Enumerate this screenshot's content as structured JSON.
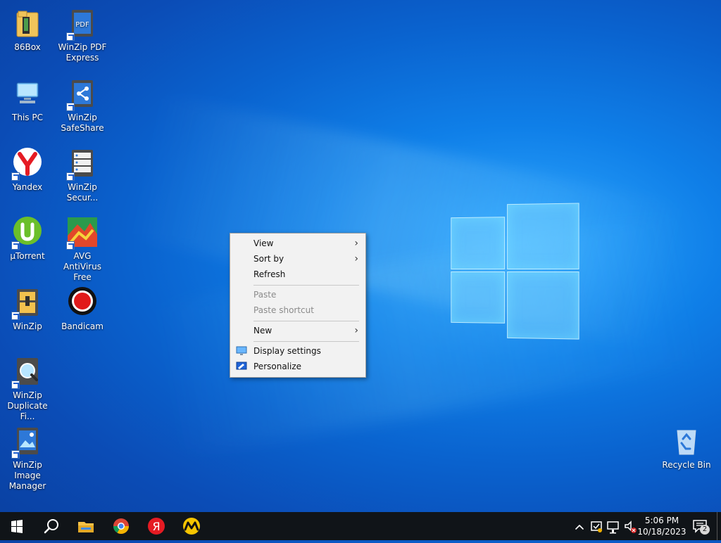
{
  "desktop": {
    "icons": [
      {
        "label": "86Box",
        "icon": "folder-icon"
      },
      {
        "label": "WinZip PDF Express",
        "icon": "pdf-document-icon"
      },
      {
        "label": "This PC",
        "icon": "computer-icon"
      },
      {
        "label": "WinZip SafeShare",
        "icon": "share-icon"
      },
      {
        "label": "Yandex",
        "icon": "yandex-browser-icon"
      },
      {
        "label": "WinZip Secur...",
        "icon": "server-icon"
      },
      {
        "label": "µTorrent",
        "icon": "utorrent-icon"
      },
      {
        "label": "AVG AntiVirus Free",
        "icon": "avg-icon"
      },
      {
        "label": "WinZip",
        "icon": "winzip-icon"
      },
      {
        "label": "Bandicam",
        "icon": "record-icon"
      },
      {
        "label": "WinZip Duplicate Fi...",
        "icon": "duplicate-finder-icon"
      },
      {
        "label": "WinZip Image Manager",
        "icon": "image-icon"
      },
      {
        "label": "Recycle Bin",
        "icon": "recycle-bin-icon"
      }
    ]
  },
  "context_menu": {
    "view": "View",
    "sort_by": "Sort by",
    "refresh": "Refresh",
    "paste": "Paste",
    "paste_shortcut": "Paste shortcut",
    "new": "New",
    "display_settings": "Display settings",
    "personalize": "Personalize"
  },
  "taskbar": {
    "pinned": [
      "start-icon",
      "search-icon",
      "file-explorer-icon",
      "chrome-icon",
      "yandex-icon",
      "yandex-market-icon"
    ],
    "time": "5:06 PM",
    "date": "10/18/2023",
    "notifications_count": "2"
  },
  "colors": {
    "taskbar_bg": "#101418",
    "desktop_accent": "#0a63cf",
    "menu_bg": "#f2f2f2"
  }
}
